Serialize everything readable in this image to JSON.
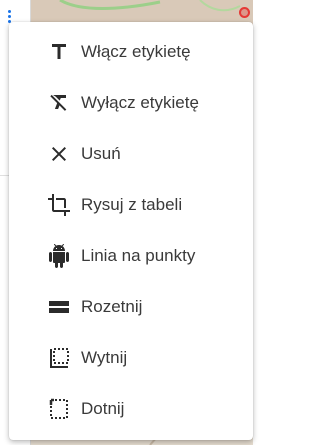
{
  "menu": {
    "items": [
      {
        "label": "Włącz etykietę",
        "icon": "text-icon"
      },
      {
        "label": "Wyłącz etykietę",
        "icon": "text-off-icon"
      },
      {
        "label": "Usuń",
        "icon": "close-icon"
      },
      {
        "label": "Rysuj z tabeli",
        "icon": "crop-icon"
      },
      {
        "label": "Linia na punkty",
        "icon": "android-icon"
      },
      {
        "label": "Rozetnij",
        "icon": "split-icon"
      },
      {
        "label": "Wytnij",
        "icon": "cut-area-icon"
      },
      {
        "label": "Dotnij",
        "icon": "trim-area-icon"
      }
    ]
  },
  "colors": {
    "icon": "#2b2b2b",
    "text": "#3a3a3a",
    "map_land": "#efe6dc",
    "map_green": "#cfe3b8",
    "marker": "#e53935",
    "panel_accent": "#1a73e8"
  }
}
